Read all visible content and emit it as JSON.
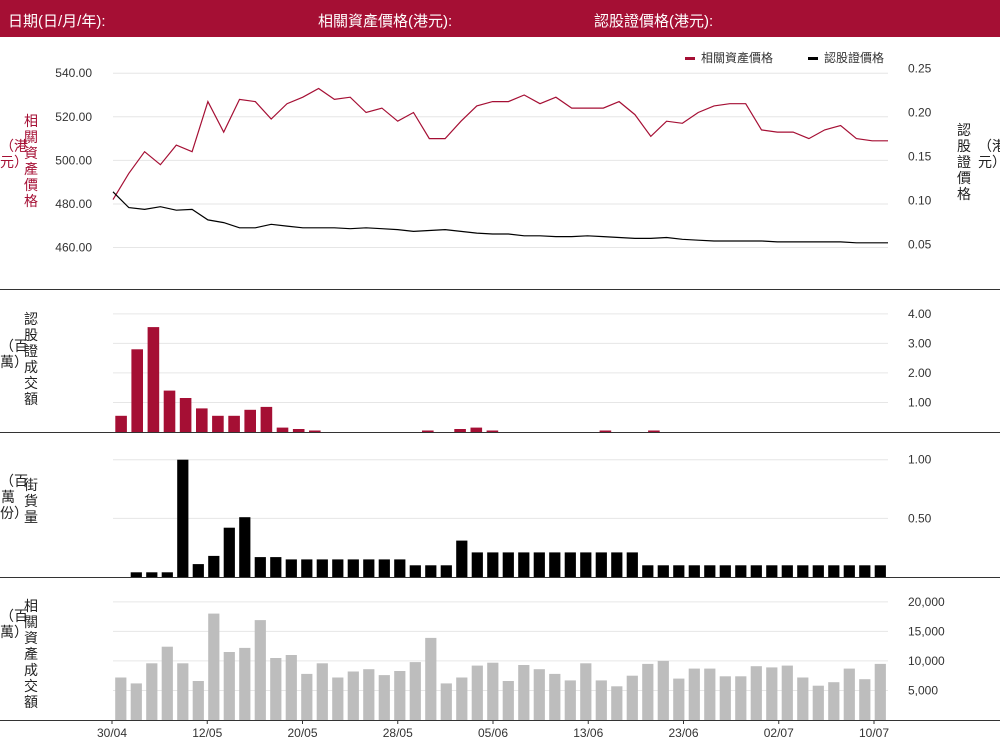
{
  "header": {
    "date_label": "日期(日/月/年):",
    "underlying_label": "相關資產價格(港元):",
    "warrant_label": "認股證價格(港元):"
  },
  "legend": {
    "underlying": "相關資產價格",
    "warrant": "認股證價格"
  },
  "colors": {
    "brand": "#a50f34",
    "warrant": "#000000",
    "turnover_underlying": "#bdbdbd",
    "grid": "#e6e6e6"
  },
  "labels": {
    "price_left": "相關資產價格",
    "price_left_unit": "（港元）",
    "price_right": "認股證價格",
    "price_right_unit": "（港元）",
    "warrant_turnover": "認股證成交額",
    "warrant_turnover_unit": "（百萬）",
    "outstanding": "街貨量",
    "outstanding_unit": "（百萬份）",
    "underlying_turnover": "相關資產成交額",
    "underlying_turnover_unit": "（百萬）"
  },
  "chart_data": [
    {
      "type": "line",
      "x_ticks": [
        "30/04",
        "12/05",
        "20/05",
        "28/05",
        "05/06",
        "13/06",
        "23/06",
        "02/07",
        "10/07"
      ],
      "series": [
        {
          "name": "相關資產價格",
          "axis": "left",
          "values": [
            482,
            494,
            504,
            498,
            507,
            504,
            527,
            513,
            528,
            527,
            519,
            526,
            529,
            533,
            528,
            529,
            522,
            524,
            518,
            522,
            510,
            510,
            518,
            525,
            527,
            527,
            530,
            526,
            529,
            524,
            524,
            524,
            527,
            521,
            511,
            518,
            517,
            522,
            525,
            526,
            526,
            514,
            513,
            513,
            510,
            514,
            516,
            510,
            509,
            509
          ]
        },
        {
          "name": "認股證價格",
          "axis": "right",
          "values": [
            0.11,
            0.092,
            0.09,
            0.093,
            0.089,
            0.09,
            0.078,
            0.075,
            0.069,
            0.069,
            0.073,
            0.071,
            0.069,
            0.069,
            0.069,
            0.068,
            0.069,
            0.068,
            0.067,
            0.065,
            0.066,
            0.067,
            0.065,
            0.063,
            0.062,
            0.062,
            0.06,
            0.06,
            0.059,
            0.059,
            0.06,
            0.059,
            0.058,
            0.057,
            0.057,
            0.058,
            0.056,
            0.055,
            0.054,
            0.054,
            0.054,
            0.054,
            0.053,
            0.053,
            0.053,
            0.053,
            0.053,
            0.052,
            0.052,
            0.052
          ]
        }
      ],
      "left_ticks": [
        "540.00",
        "520.00",
        "500.00",
        "480.00",
        "460.00"
      ],
      "left_tick_values": [
        540,
        520,
        500,
        480,
        460
      ],
      "left_range": [
        446,
        547
      ],
      "right_ticks": [
        "0.25",
        "0.20",
        "0.15",
        "0.10",
        "0.05"
      ],
      "right_tick_values": [
        0.25,
        0.2,
        0.15,
        0.1,
        0.05
      ],
      "right_range": [
        0.012,
        0.262
      ]
    },
    {
      "type": "bar",
      "values": [
        0.55,
        2.8,
        3.55,
        1.4,
        1.15,
        0.8,
        0.55,
        0.55,
        0.75,
        0.85,
        0.15,
        0.1,
        0.05,
        0,
        0,
        0,
        0,
        0,
        0,
        0.05,
        0,
        0.1,
        0.15,
        0.05,
        0,
        0,
        0,
        0,
        0,
        0,
        0.05,
        0,
        0,
        0.05,
        0,
        0,
        0,
        0,
        0,
        0,
        0,
        0,
        0,
        0,
        0,
        0,
        0,
        0
      ],
      "ticks": [
        "4.00",
        "3.00",
        "2.00",
        "1.00"
      ],
      "tick_values": [
        4,
        3,
        2,
        1
      ],
      "range": [
        0,
        4.4
      ]
    },
    {
      "type": "bar",
      "values": [
        0,
        0.04,
        0.04,
        0.04,
        1.0,
        0.11,
        0.18,
        0.42,
        0.51,
        0.17,
        0.17,
        0.15,
        0.15,
        0.15,
        0.15,
        0.15,
        0.15,
        0.15,
        0.15,
        0.1,
        0.1,
        0.1,
        0.31,
        0.21,
        0.21,
        0.21,
        0.21,
        0.21,
        0.21,
        0.21,
        0.21,
        0.21,
        0.21,
        0.21,
        0.1,
        0.1,
        0.1,
        0.1,
        0.1,
        0.1,
        0.1,
        0.1,
        0.1,
        0.1,
        0.1,
        0.1,
        0.1,
        0.1,
        0.1,
        0.1
      ],
      "ticks": [
        "1.00",
        "0.50"
      ],
      "tick_values": [
        1.0,
        0.5
      ],
      "range": [
        0,
        1.1
      ]
    },
    {
      "type": "bar",
      "values": [
        7200,
        6200,
        9600,
        12400,
        9600,
        6600,
        18000,
        11500,
        12200,
        16900,
        10500,
        11000,
        7800,
        9600,
        7200,
        8200,
        8600,
        7600,
        8300,
        9800,
        13900,
        6200,
        7200,
        9200,
        9700,
        6600,
        9300,
        8600,
        7800,
        6700,
        9600,
        6700,
        5700,
        7500,
        9500,
        10000,
        7000,
        8700,
        8700,
        7400,
        7400,
        9100,
        8900,
        9200,
        7200,
        5800,
        6400,
        8700,
        6900,
        9500
      ],
      "ticks": [
        "20,000",
        "15,000",
        "10,000",
        "5,000"
      ],
      "tick_values": [
        20000,
        15000,
        10000,
        5000
      ],
      "range": [
        0,
        22000
      ]
    }
  ]
}
